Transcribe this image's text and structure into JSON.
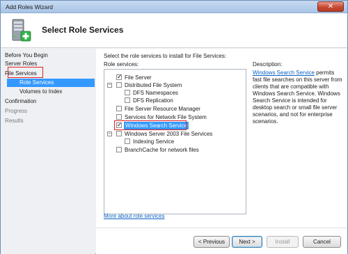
{
  "window": {
    "title": "Add Roles Wizard",
    "close_glyph": "✕"
  },
  "header": {
    "title": "Select Role Services",
    "icon": "server-add-icon"
  },
  "sidebar": {
    "items": [
      {
        "label": "Before You Begin"
      },
      {
        "label": "Server Roles"
      },
      {
        "label": "File Services"
      },
      {
        "label": "Role Services"
      },
      {
        "label": "Volumes to Index"
      },
      {
        "label": "Confirmation"
      },
      {
        "label": "Progress"
      },
      {
        "label": "Results"
      }
    ]
  },
  "main": {
    "instructions": "Select the role services to install for File Services:",
    "list_label": "Role services:",
    "tree": [
      {
        "label": "File Server",
        "checked": true
      },
      {
        "label": "Distributed File System",
        "checked": false,
        "expander": "⊟"
      },
      {
        "label": "DFS Namespaces",
        "checked": false
      },
      {
        "label": "DFS Replication",
        "checked": false
      },
      {
        "label": "File Server Resource Manager",
        "checked": false
      },
      {
        "label": "Services for Network File System",
        "checked": false
      },
      {
        "label": "Windows Search Service",
        "checked": true
      },
      {
        "label": "Windows Server 2003 File Services",
        "checked": false,
        "expander": "⊟"
      },
      {
        "label": "Indexing Service",
        "checked": false
      },
      {
        "label": "BranchCache for network files",
        "checked": false
      }
    ],
    "description_label": "Description:",
    "description_link": "Windows Search Service",
    "description_text": " permits fast file searches on this server from clients that are compatible with Windows Search Service. Windows Search Service is intended for desktop search or small file server scenarios, and not for enterprise scenarios.",
    "more_link": "More about role services"
  },
  "buttons": {
    "previous": "< Previous",
    "next": "Next >",
    "install": "Install",
    "cancel": "Cancel"
  },
  "colors": {
    "selection": "#3399ff",
    "link": "#0b62c4",
    "highlight_outline": "#e02020"
  }
}
